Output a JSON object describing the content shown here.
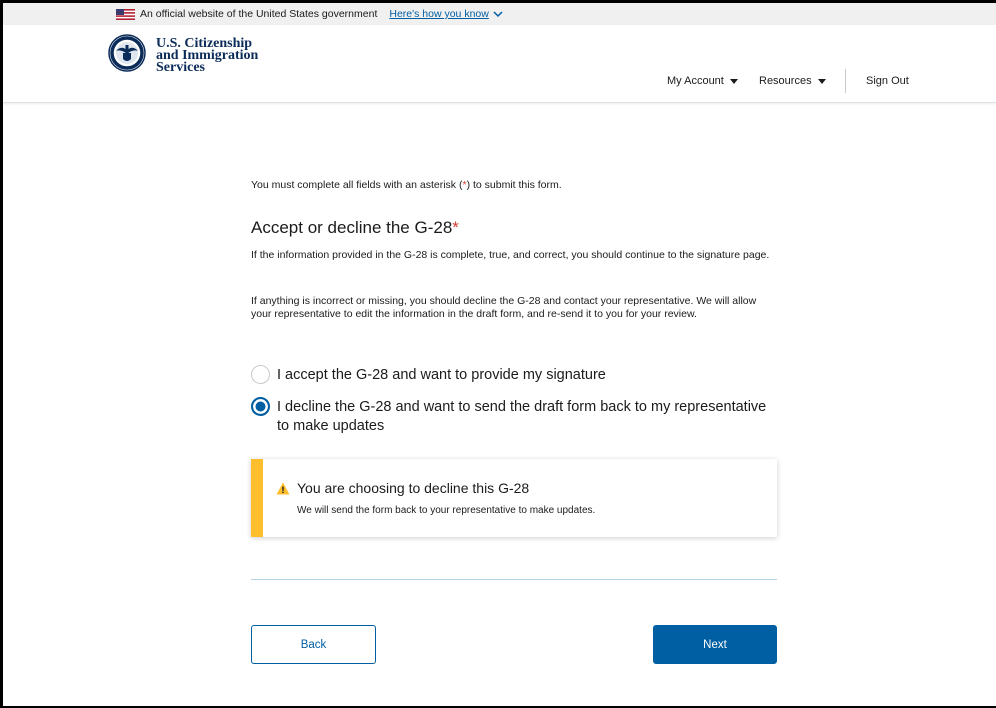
{
  "banner": {
    "text": "An official website of the United States government",
    "link": "Here's how you know"
  },
  "header": {
    "agency_line1": "U.S. Citizenship",
    "agency_line2": "and Immigration",
    "agency_line3": "Services",
    "nav": {
      "my_account": "My Account",
      "resources": "Resources",
      "sign_out": "Sign Out"
    }
  },
  "form": {
    "required_note_prefix": "You must complete all fields with an asterisk (",
    "required_note_asterisk": "*",
    "required_note_suffix": ") to submit this form.",
    "title": "Accept or decline the G-28",
    "title_asterisk": "*",
    "paragraph1": "If the information provided in the G-28 is complete, true, and correct, you should continue to the signature page.",
    "paragraph2": "If anything is incorrect or missing, you should decline the G-28 and contact your representative. We will allow your representative to edit the information in the draft form, and re-send it to you for your review.",
    "options": [
      {
        "label": "I accept the G-28 and want to provide my signature",
        "selected": false
      },
      {
        "label": "I decline the G-28 and want to send the draft form back to my representative to make updates",
        "selected": true
      }
    ],
    "alert": {
      "heading": "You are choosing to decline this G-28",
      "body": "We will send the form back to your representative to make updates."
    },
    "buttons": {
      "back": "Back",
      "next": "Next"
    }
  },
  "colors": {
    "primary": "#005ea2",
    "warning": "#ffbe2e",
    "required": "#d83933",
    "agency_navy": "#0b2b59"
  }
}
